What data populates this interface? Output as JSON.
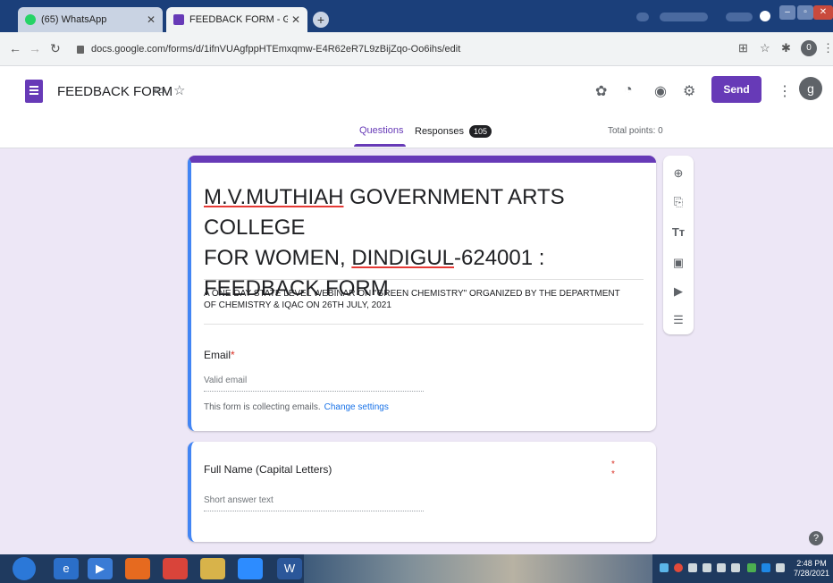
{
  "browser": {
    "tabs": [
      {
        "title": "(65) WhatsApp",
        "icon": "whatsapp-icon",
        "active": false
      },
      {
        "title": "FEEDBACK FORM - Google Form",
        "icon": "google-forms-icon",
        "active": true
      }
    ],
    "url": "docs.google.com/forms/d/1ifnVUAgfppHTEmxqmw-E4R62eR7L9zBijZqo-Oo6ihs/edit",
    "profile_initial": "0"
  },
  "forms_header": {
    "doc_title": "FEEDBACK FORM",
    "send_label": "Send",
    "avatar_initial": "g",
    "tabs": [
      {
        "label": "Questions",
        "active": true
      },
      {
        "label": "Responses",
        "badge": "105",
        "active": false
      }
    ],
    "total_points": "Total points: 0"
  },
  "form": {
    "title_line1_underlined": "M.V.MUTHIAH",
    "title_line1_rest": " GOVERNMENT ARTS COLLEGE",
    "title_line2_start": "FOR WOMEN, ",
    "title_line2_underlined": "DINDIGUL",
    "title_line2_rest": "-624001  :",
    "title_line3": "FEEDBACK FORM",
    "description": "A ONE DAY STATE LEVEL WEBINAR ON \"GREEN CHEMISTRY\" ORGANIZED BY THE DEPARTMENT OF CHEMISTRY & IQAC ON 26TH JULY, 2021",
    "email_label": "Email",
    "required_mark": "*",
    "email_placeholder": "Valid email",
    "collecting_text": "This form is collecting emails.",
    "change_settings": "Change settings",
    "question2_label": "Full Name (Capital Letters)",
    "question2_dots": "* *",
    "question2_placeholder": "Short answer text"
  },
  "taskbar": {
    "time": "2:48 PM",
    "date": "7/28/2021"
  },
  "colors": {
    "forms_purple": "#673ab7",
    "canvas_bg": "#ede7f6",
    "active_blue": "#4285f4",
    "required_red": "#d93025",
    "link_blue": "#1a73e8"
  }
}
